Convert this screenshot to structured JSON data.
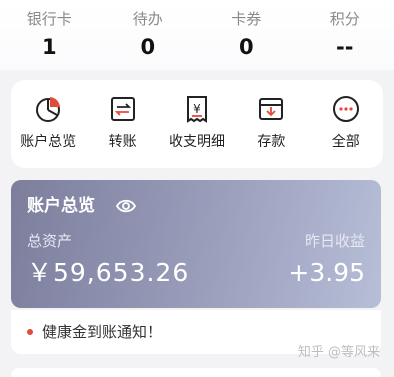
{
  "stats": [
    {
      "label": "银行卡",
      "value": "1"
    },
    {
      "label": "待办",
      "value": "0"
    },
    {
      "label": "卡券",
      "value": "0"
    },
    {
      "label": "积分",
      "value": "--"
    }
  ],
  "actions": [
    {
      "label": "账户总览",
      "icon": "pie-chart-icon"
    },
    {
      "label": "转账",
      "icon": "transfer-icon"
    },
    {
      "label": "收支明细",
      "icon": "receipt-yen-icon"
    },
    {
      "label": "存款",
      "icon": "deposit-icon"
    },
    {
      "label": "全部",
      "icon": "more-dots-icon"
    }
  ],
  "card": {
    "title": "账户总览",
    "total_assets_label": "总资产",
    "total_assets": "￥59,653.26",
    "yesterday_income_label": "昨日收益",
    "yesterday_income": "+3.95"
  },
  "notice": {
    "text": "健康金到账通知！"
  },
  "watermark": "知乎 @等风来",
  "colors": {
    "card_gradient_start": "#7c7e9c",
    "card_gradient_end": "#b7bed7",
    "notice_dot": "#e24a3b"
  }
}
